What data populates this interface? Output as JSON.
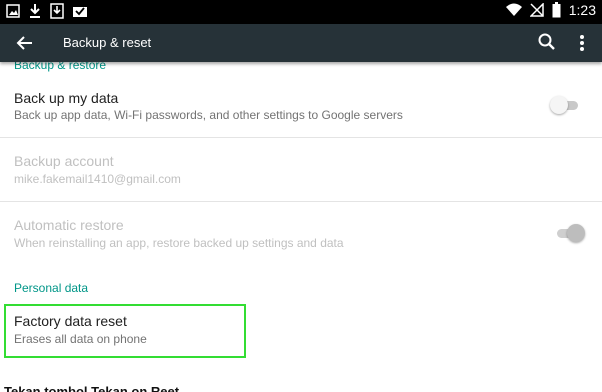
{
  "status_bar": {
    "left_icons": [
      "gallery-icon",
      "download-icon",
      "download-box-icon",
      "email-check-icon"
    ],
    "right_icons": [
      "wifi-icon",
      "signal-off-icon",
      "battery-icon"
    ],
    "time": "1:23"
  },
  "toolbar": {
    "back_icon": "arrow-back-icon",
    "title": "Backup & reset",
    "search_icon": "search-icon",
    "menu_icon": "more-vert-icon",
    "background_color": "#263238"
  },
  "sections": {
    "backup_restore": {
      "header": "Backup & restore",
      "items": [
        {
          "title": "Back up my data",
          "summary": "Back up app data, Wi-Fi passwords, and other settings to Google servers",
          "switch": "off",
          "enabled": true
        },
        {
          "title": "Backup account",
          "summary": "mike.fakemail1410@gmail.com",
          "enabled": false
        },
        {
          "title": "Automatic restore",
          "summary": "When reinstalling an app, restore backed up settings and data",
          "switch": "on",
          "enabled": false
        }
      ]
    },
    "personal_data": {
      "header": "Personal data",
      "items": [
        {
          "title": "Factory data reset",
          "summary": "Erases all data on phone",
          "enabled": true
        }
      ]
    }
  },
  "accent_color": "#009688",
  "highlight_color": "#33dd33",
  "caption": "Tekan tombol Tekan on Reet"
}
